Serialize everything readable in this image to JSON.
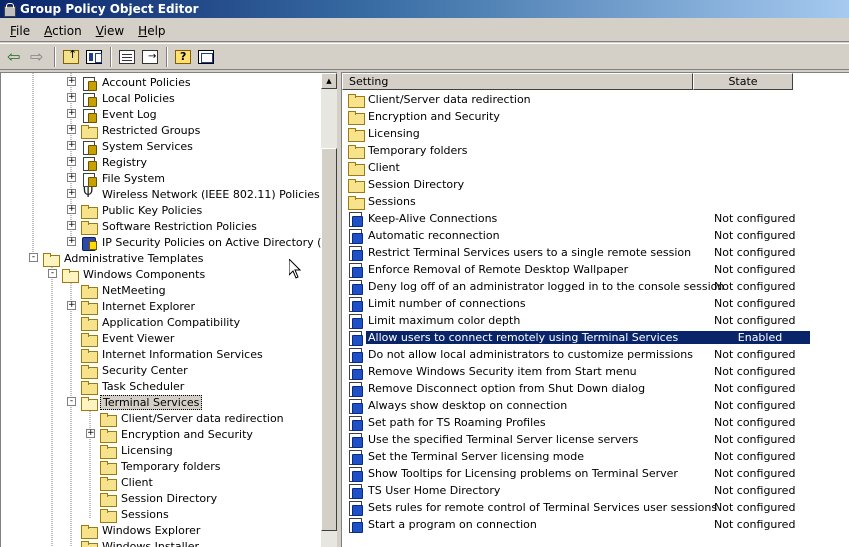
{
  "window": {
    "title": "Group Policy Object Editor"
  },
  "menu": [
    {
      "label_pre": "",
      "label_ul": "F",
      "label_post": "ile"
    },
    {
      "label_pre": "",
      "label_ul": "A",
      "label_post": "ction"
    },
    {
      "label_pre": "",
      "label_ul": "V",
      "label_post": "iew"
    },
    {
      "label_pre": "",
      "label_ul": "H",
      "label_post": "elp"
    }
  ],
  "toolbar": {
    "icons": [
      "back-icon",
      "forward-icon",
      "up-one-level-icon",
      "show-hide-tree-icon",
      "properties-icon",
      "export-list-icon",
      "help-icon",
      "show-hide-console-tree-icon"
    ]
  },
  "tree": [
    {
      "label": "Account Policies",
      "icon": "policy",
      "expander": "+"
    },
    {
      "label": "Local Policies",
      "icon": "policy",
      "expander": "+"
    },
    {
      "label": "Event Log",
      "icon": "policy",
      "expander": "+"
    },
    {
      "label": "Restricted Groups",
      "icon": "folder",
      "expander": "+"
    },
    {
      "label": "System Services",
      "icon": "policy",
      "expander": "+"
    },
    {
      "label": "Registry",
      "icon": "policy",
      "expander": "+"
    },
    {
      "label": "File System",
      "icon": "policy",
      "expander": "+"
    },
    {
      "label": "Wireless Network (IEEE 802.11) Policies",
      "icon": "wireless",
      "expander": "+"
    },
    {
      "label": "Public Key Policies",
      "icon": "folder",
      "expander": "+"
    },
    {
      "label": "Software Restriction Policies",
      "icon": "folder",
      "expander": "+"
    },
    {
      "label": "IP Security Policies on Active Directory (fuckthi",
      "icon": "ipsec",
      "expander": "+"
    },
    {
      "label": "Administrative Templates",
      "icon": "open",
      "expander": "-"
    },
    {
      "label": "Windows Components",
      "icon": "open",
      "expander": "-"
    },
    {
      "label": "NetMeeting",
      "icon": "folder",
      "expander": ""
    },
    {
      "label": "Internet Explorer",
      "icon": "folder",
      "expander": "+"
    },
    {
      "label": "Application Compatibility",
      "icon": "folder",
      "expander": ""
    },
    {
      "label": "Event Viewer",
      "icon": "folder",
      "expander": ""
    },
    {
      "label": "Internet Information Services",
      "icon": "folder",
      "expander": ""
    },
    {
      "label": "Security Center",
      "icon": "folder",
      "expander": ""
    },
    {
      "label": "Task Scheduler",
      "icon": "folder",
      "expander": ""
    },
    {
      "label": "Terminal Services",
      "icon": "open",
      "expander": "-",
      "selected": true
    },
    {
      "label": "Client/Server data redirection",
      "icon": "folder",
      "expander": ""
    },
    {
      "label": "Encryption and Security",
      "icon": "folder",
      "expander": "+"
    },
    {
      "label": "Licensing",
      "icon": "folder",
      "expander": ""
    },
    {
      "label": "Temporary folders",
      "icon": "folder",
      "expander": ""
    },
    {
      "label": "Client",
      "icon": "folder",
      "expander": ""
    },
    {
      "label": "Session Directory",
      "icon": "folder",
      "expander": ""
    },
    {
      "label": "Sessions",
      "icon": "folder",
      "expander": ""
    },
    {
      "label": "Windows Explorer",
      "icon": "folder",
      "expander": ""
    },
    {
      "label": "Windows Installer",
      "icon": "folder",
      "expander": ""
    }
  ],
  "list": {
    "columns": {
      "setting": "Setting",
      "state": "State"
    },
    "rows": [
      {
        "name": "Client/Server data redirection",
        "state": "",
        "type": "folder"
      },
      {
        "name": "Encryption and Security",
        "state": "",
        "type": "folder"
      },
      {
        "name": "Licensing",
        "state": "",
        "type": "folder"
      },
      {
        "name": "Temporary folders",
        "state": "",
        "type": "folder"
      },
      {
        "name": "Client",
        "state": "",
        "type": "folder"
      },
      {
        "name": "Session Directory",
        "state": "",
        "type": "folder"
      },
      {
        "name": "Sessions",
        "state": "",
        "type": "folder"
      },
      {
        "name": "Keep-Alive Connections",
        "state": "Not configured",
        "type": "setting"
      },
      {
        "name": "Automatic reconnection",
        "state": "Not configured",
        "type": "setting"
      },
      {
        "name": "Restrict Terminal Services users to a single remote session",
        "state": "Not configured",
        "type": "setting"
      },
      {
        "name": "Enforce Removal of Remote Desktop Wallpaper",
        "state": "Not configured",
        "type": "setting"
      },
      {
        "name": "Deny log off of an administrator logged in to the console session",
        "state": "Not configured",
        "type": "setting"
      },
      {
        "name": "Limit number of connections",
        "state": "Not configured",
        "type": "setting"
      },
      {
        "name": "Limit maximum color depth",
        "state": "Not configured",
        "type": "setting"
      },
      {
        "name": "Allow users to connect remotely using Terminal Services",
        "state": "Enabled",
        "type": "setting",
        "selected": true
      },
      {
        "name": "Do not allow local administrators to customize permissions",
        "state": "Not configured",
        "type": "setting"
      },
      {
        "name": "Remove Windows Security item from Start menu",
        "state": "Not configured",
        "type": "setting"
      },
      {
        "name": "Remove Disconnect option from Shut Down dialog",
        "state": "Not configured",
        "type": "setting"
      },
      {
        "name": "Always show desktop on connection",
        "state": "Not configured",
        "type": "setting"
      },
      {
        "name": "Set path for TS Roaming Profiles",
        "state": "Not configured",
        "type": "setting"
      },
      {
        "name": "Use the specified Terminal Server license servers",
        "state": "Not configured",
        "type": "setting"
      },
      {
        "name": "Set the Terminal Server licensing mode",
        "state": "Not configured",
        "type": "setting"
      },
      {
        "name": "Show Tooltips for Licensing problems on Terminal Server",
        "state": "Not configured",
        "type": "setting"
      },
      {
        "name": "TS User Home Directory",
        "state": "Not configured",
        "type": "setting"
      },
      {
        "name": "Sets rules for remote control of Terminal Services user sessions",
        "state": "Not configured",
        "type": "setting"
      },
      {
        "name": "Start a program on connection",
        "state": "Not configured",
        "type": "setting"
      }
    ]
  }
}
